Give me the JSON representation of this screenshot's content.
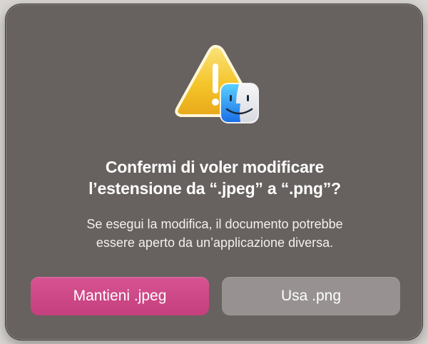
{
  "dialog": {
    "title_line1": "Confermi di voler modificare",
    "title_line2": "l’estensione da “.jpeg” a “.png”?",
    "message_line1": "Se esegui la modifica, il documento potrebbe",
    "message_line2": "essere aperto da un’applicazione diversa.",
    "icons": {
      "main": "warning-icon",
      "badge": "finder-icon"
    }
  },
  "buttons": {
    "keep_label": "Mantieni .jpeg",
    "use_label": "Usa .png"
  },
  "colors": {
    "dialog_background": "#67615f",
    "keep_button": "#d04b89",
    "use_button": "#979291",
    "warning_yellow": "#f5c622"
  }
}
